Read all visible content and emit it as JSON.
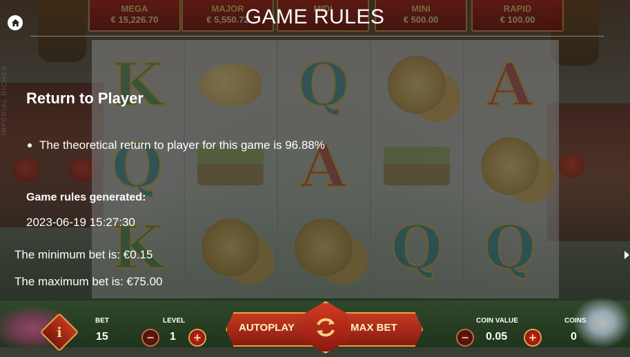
{
  "game": {
    "brand_vertical": "IMPERIAL RICHES"
  },
  "jackpots": [
    {
      "name": "MEGA",
      "value": "€ 15,226.70"
    },
    {
      "name": "MAJOR",
      "value": "€ 5,550.72"
    },
    {
      "name": "MIDI",
      "value": ""
    },
    {
      "name": "MINI",
      "value": "€ 500.00"
    },
    {
      "name": "RAPID",
      "value": "€ 100.00"
    }
  ],
  "rules": {
    "title": "GAME RULES",
    "rtp_heading": "Return to Player",
    "rtp_text": "The theoretical return to player for this game is 96.88%",
    "generated_heading": "Game rules generated:",
    "generated_date": "2023-06-19 15:27:30",
    "min_bet": "The minimum bet is: €0.15",
    "max_bet": "The maximum bet is: €75.00"
  },
  "reels": [
    [
      "K",
      "Q",
      "K"
    ],
    [
      "fish",
      "bamboo",
      "coins"
    ],
    [
      "Q",
      "A",
      "coins"
    ],
    [
      "coins",
      "bamboo",
      "Q"
    ],
    [
      "A",
      "coins",
      "Q"
    ]
  ],
  "controls": {
    "info_label": "i",
    "bet_label": "BET",
    "bet_value": "15",
    "level_label": "LEVEL",
    "level_value": "1",
    "autoplay_label": "AUTOPLAY",
    "maxbet_label": "MAX BET",
    "coin_value_label": "COIN VALUE",
    "coin_value": "0.05",
    "coins_label": "COINS",
    "coins_value": "0",
    "minus_glyph": "−",
    "plus_glyph": "+"
  },
  "colors": {
    "accent_gold": "#e1a543",
    "button_red": "#c43a22"
  }
}
